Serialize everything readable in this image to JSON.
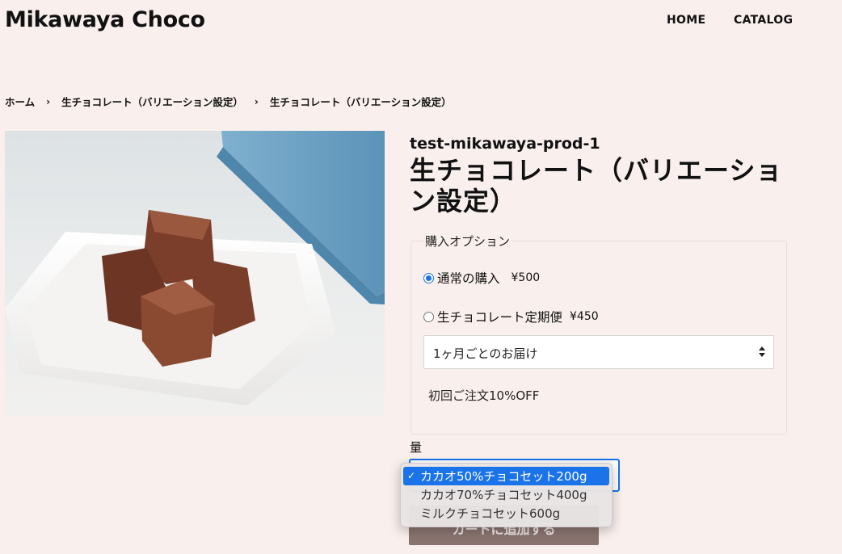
{
  "header": {
    "brand": "Mikawaya Choco",
    "nav": {
      "home": "HOME",
      "catalog": "CATALOG"
    }
  },
  "breadcrumb": {
    "items": [
      "ホーム",
      "生チョコレート（バリエーション設定）",
      "生チョコレート（バリエーション設定）"
    ],
    "separator": "›"
  },
  "product": {
    "sku": "test-mikawaya-prod-1",
    "title": "生チョコレート（バリエーション設定）",
    "image_icon": "chocolate-product-photo"
  },
  "purchase": {
    "legend": "購入オプション",
    "options": [
      {
        "label": "通常の購入",
        "price": "¥500",
        "selected": true
      },
      {
        "label": "生チョコレート定期便",
        "price": "¥450",
        "selected": false
      }
    ],
    "interval_value": "1ヶ月ごとのお届け",
    "discount_note": "初回ご注文10%OFF"
  },
  "quantity": {
    "label": "量",
    "options": [
      "カカオ50%チョコセット200g",
      "カカオ70%チョコセット400g",
      "ミルクチョコセット600g"
    ],
    "selected_index": 0
  },
  "cart_button": "カートに追加する",
  "colors": {
    "background": "#f9efed",
    "accent": "#1a73e8",
    "button": "#8a7470"
  }
}
